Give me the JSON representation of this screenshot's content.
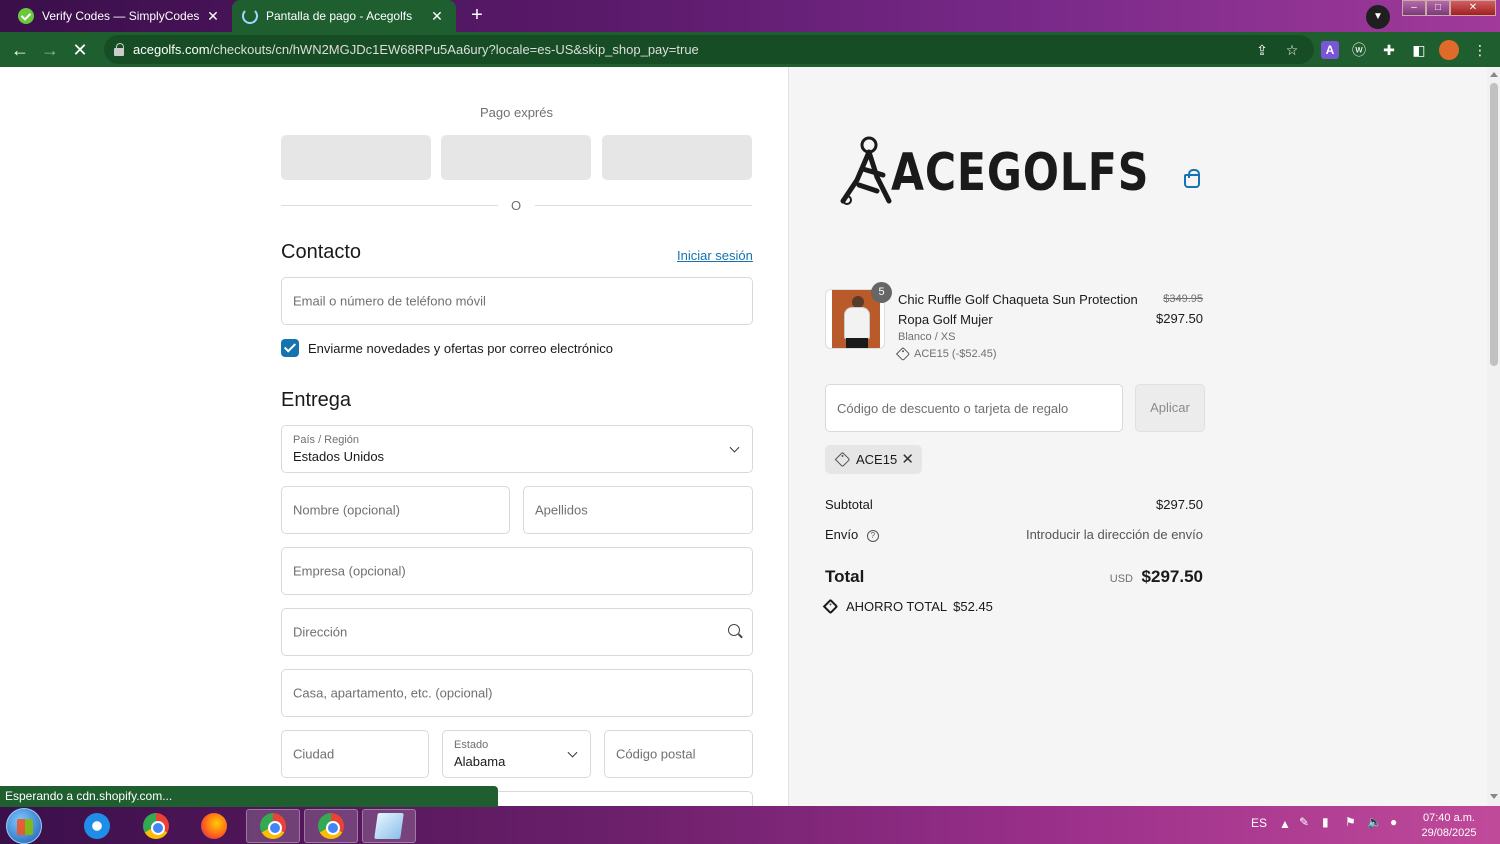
{
  "browser": {
    "tabs": [
      {
        "title": "Verify Codes — SimplyCodes",
        "active": false
      },
      {
        "title": "Pantalla de pago - Acegolfs",
        "active": true
      }
    ],
    "url_host": "acegolfs.com",
    "url_path": "/checkouts/cn/hWN2MGJDc1EW68RPu5Aa6ury?locale=es-US&skip_shop_pay=true",
    "status_text": "Esperando a cdn.shopify.com..."
  },
  "checkout": {
    "express_label": "Pago exprés",
    "or_label": "O",
    "contact": {
      "heading": "Contacto",
      "login_link": "Iniciar sesión",
      "email_placeholder": "Email o número de teléfono móvil",
      "newsletter_label": "Enviarme novedades y ofertas por correo electrónico",
      "newsletter_checked": true
    },
    "delivery": {
      "heading": "Entrega",
      "country_label": "País / Región",
      "country_value": "Estados Unidos",
      "first_name_placeholder": "Nombre (opcional)",
      "last_name_placeholder": "Apellidos",
      "company_placeholder": "Empresa (opcional)",
      "address_placeholder": "Dirección",
      "apartment_placeholder": "Casa, apartamento, etc. (opcional)",
      "city_placeholder": "Ciudad",
      "state_label": "Estado",
      "state_value": "Alabama",
      "zip_placeholder": "Código postal"
    }
  },
  "summary": {
    "brand": "ACEGOLFS",
    "item": {
      "quantity": "5",
      "name": "Chic Ruffle Golf Chaqueta Sun Protection Ropa Golf Mujer",
      "variant": "Blanco / XS",
      "discount": "ACE15 (-$52.45)",
      "price_original": "$349.95",
      "price": "$297.50"
    },
    "discount_placeholder": "Código de descuento o tarjeta de regalo",
    "apply_label": "Aplicar",
    "applied_code": "ACE15",
    "subtotal_label": "Subtotal",
    "subtotal_value": "$297.50",
    "shipping_label": "Envío",
    "shipping_value": "Introducir la dirección de envío",
    "total_label": "Total",
    "currency": "USD",
    "total_value": "$297.50",
    "savings_label": "AHORRO TOTAL",
    "savings_value": "$52.45"
  },
  "taskbar": {
    "language": "ES",
    "time": "07:40 a.m.",
    "date": "29/08/2025"
  },
  "colors": {
    "accent": "#1773b0",
    "browser_toolbar": "#1f5f2f"
  }
}
